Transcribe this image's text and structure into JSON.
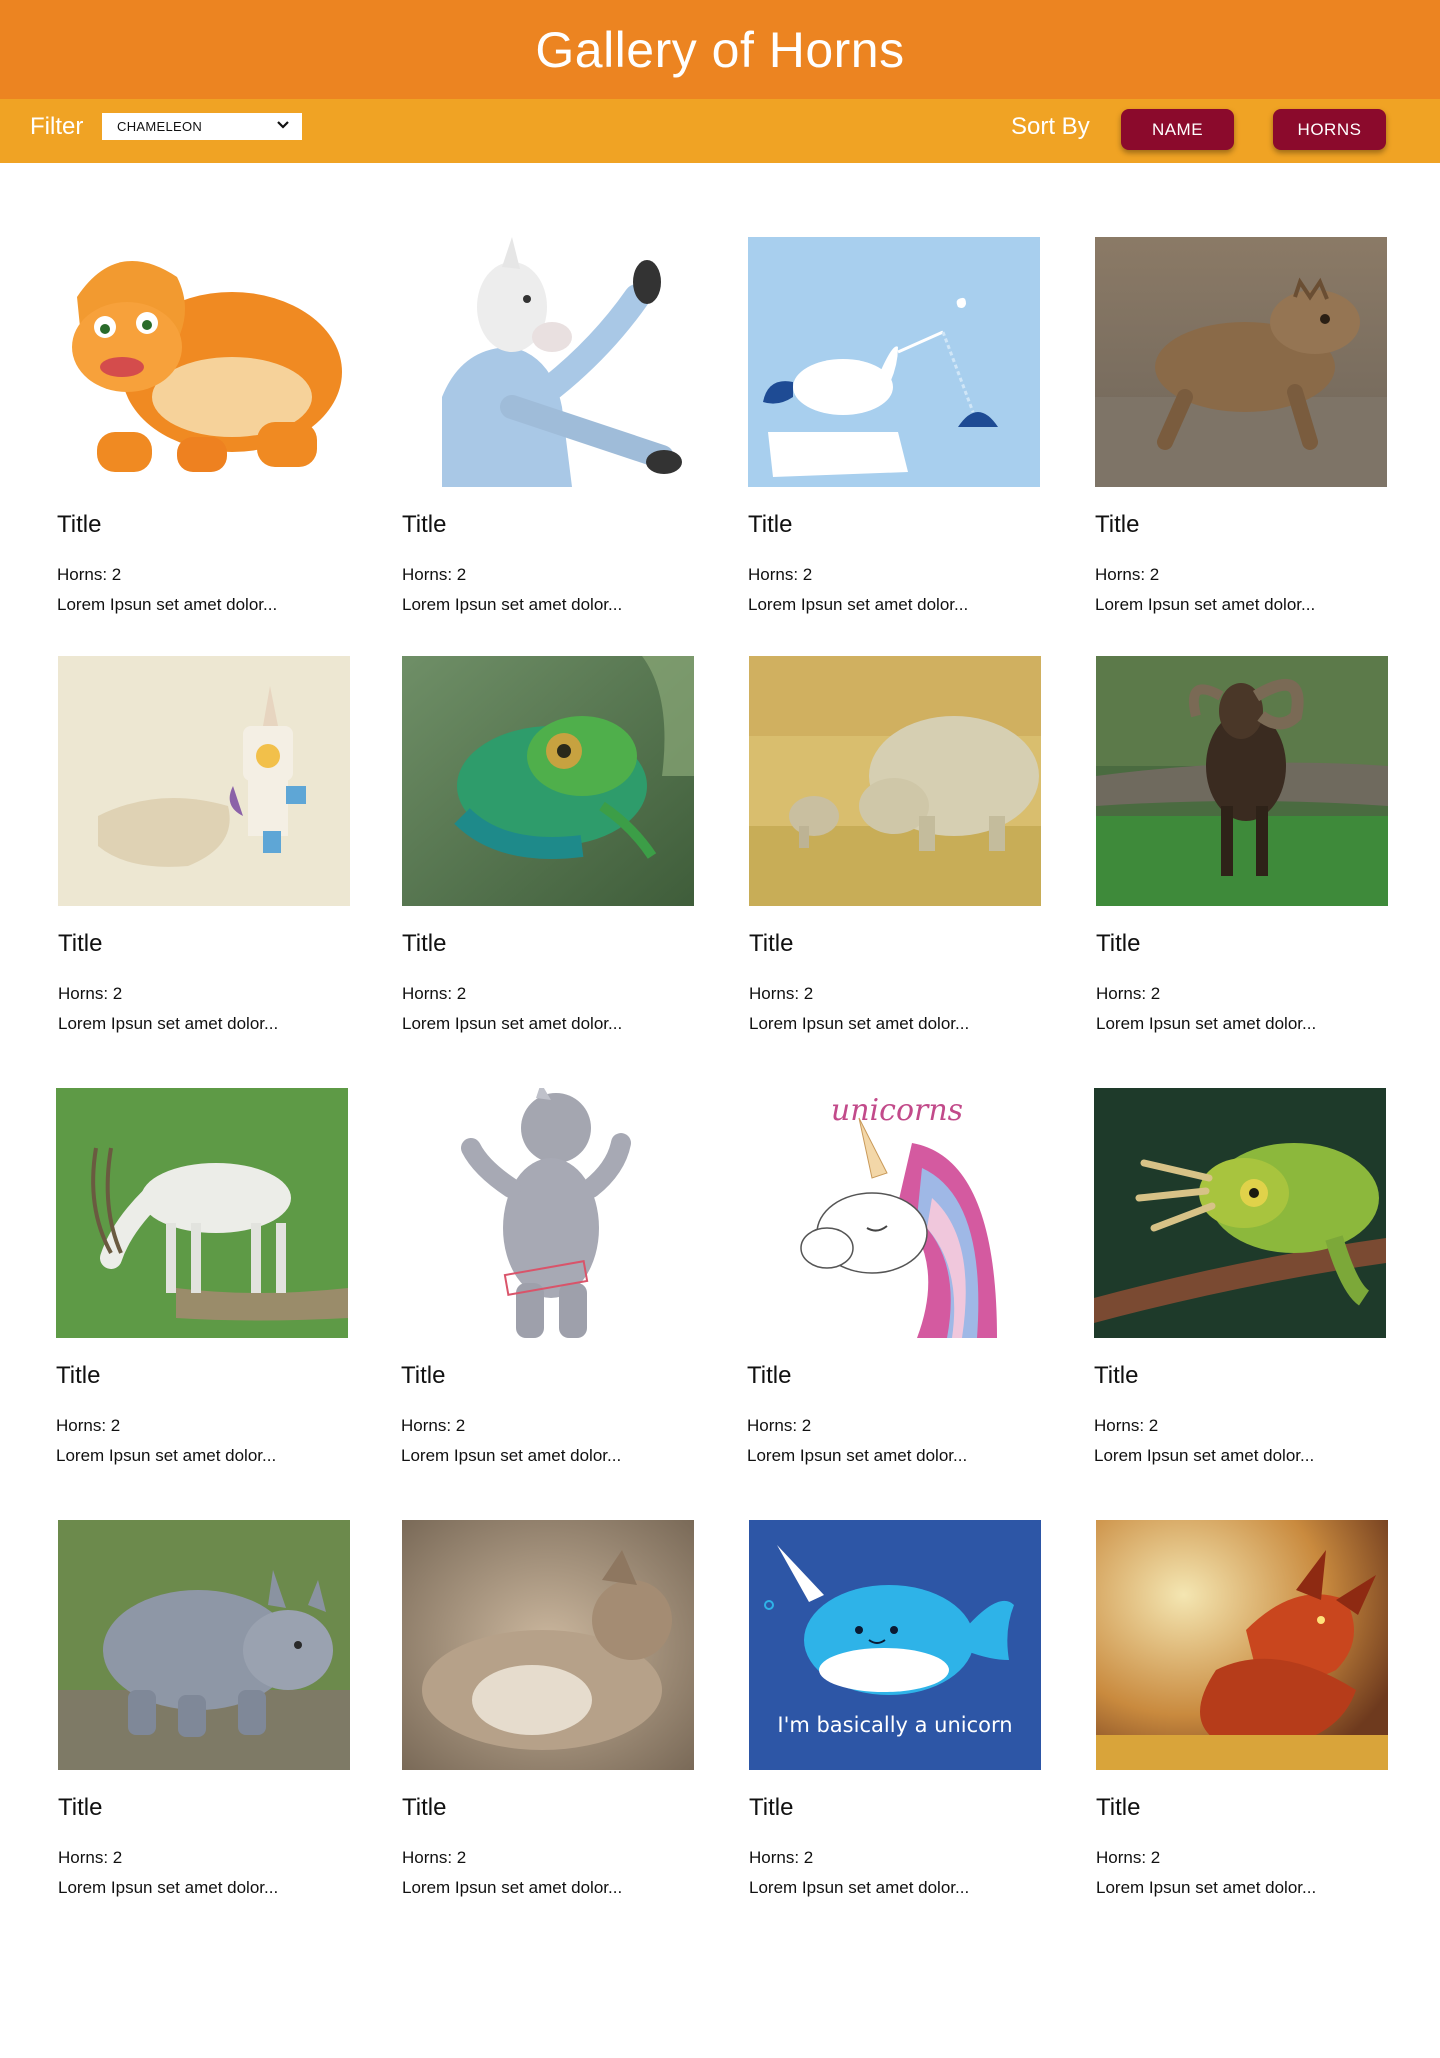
{
  "header": {
    "title": "Gallery of Horns"
  },
  "toolbar": {
    "filter_label": "Filter",
    "filter_selected": "CHAMELEON",
    "sort_label": "Sort By",
    "sort_name_label": "NAME",
    "sort_horns_label": "HORNS"
  },
  "colors": {
    "header_bg": "#EC8421",
    "toolbar_bg": "#F0A324",
    "button_bg": "#8B0A2C"
  },
  "cards": [
    {
      "title": "Title",
      "horns": "Horns: 2",
      "description": "Lorem Ipsun set amet dolor..."
    },
    {
      "title": "Title",
      "horns": "Horns: 2",
      "description": "Lorem Ipsun set amet dolor..."
    },
    {
      "title": "Title",
      "horns": "Horns: 2",
      "description": "Lorem Ipsun set amet dolor..."
    },
    {
      "title": "Title",
      "horns": "Horns: 2",
      "description": "Lorem Ipsun set amet dolor..."
    },
    {
      "title": "Title",
      "horns": "Horns: 2",
      "description": "Lorem Ipsun set amet dolor..."
    },
    {
      "title": "Title",
      "horns": "Horns: 2",
      "description": "Lorem Ipsun set amet dolor..."
    },
    {
      "title": "Title",
      "horns": "Horns: 2",
      "description": "Lorem Ipsun set amet dolor..."
    },
    {
      "title": "Title",
      "horns": "Horns: 2",
      "description": "Lorem Ipsun set amet dolor..."
    },
    {
      "title": "Title",
      "horns": "Horns: 2",
      "description": "Lorem Ipsun set amet dolor..."
    },
    {
      "title": "Title",
      "horns": "Horns: 2",
      "description": "Lorem Ipsun set amet dolor..."
    },
    {
      "title": "Title",
      "horns": "Horns: 2",
      "description": "Lorem Ipsun set amet dolor..."
    },
    {
      "title": "Title",
      "horns": "Horns: 2",
      "description": "Lorem Ipsun set amet dolor..."
    },
    {
      "title": "Title",
      "horns": "Horns: 2",
      "description": "Lorem Ipsun set amet dolor..."
    },
    {
      "title": "Title",
      "horns": "Horns: 2",
      "description": "Lorem Ipsun set amet dolor..."
    },
    {
      "title": "Title",
      "horns": "Horns: 2",
      "description": "Lorem Ipsun set amet dolor..."
    },
    {
      "title": "Title",
      "horns": "Horns: 2",
      "description": "Lorem Ipsun set amet dolor..."
    }
  ],
  "image_text": {
    "unicorns_caption": "unicorns",
    "narwhal_caption": "I'm basically a unicorn"
  }
}
